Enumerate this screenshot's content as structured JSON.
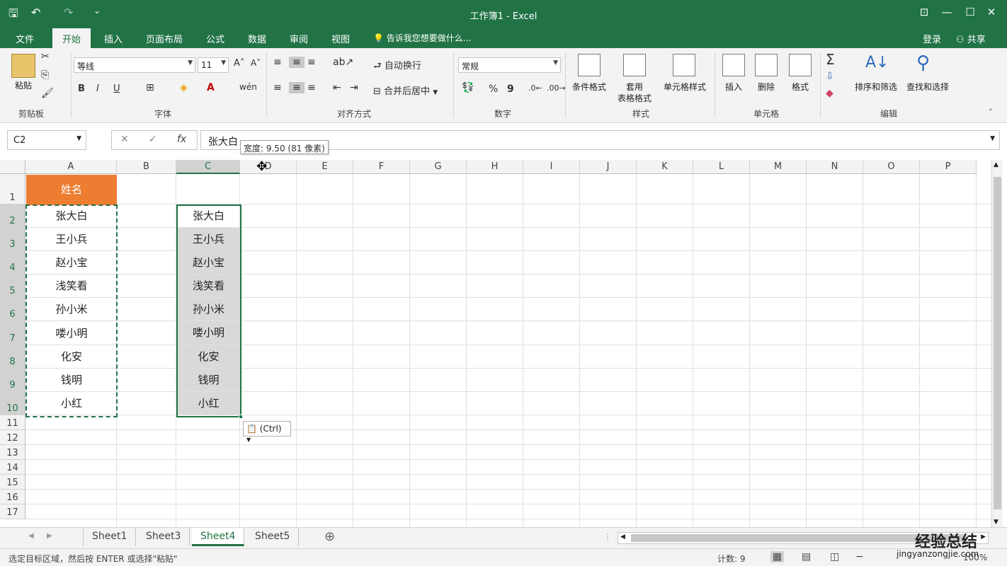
{
  "window": {
    "title": "工作簿1 - Excel",
    "quick_access": {
      "save": "🖫",
      "undo": "↶",
      "redo": "↷",
      "customize": "⌄"
    },
    "controls": {
      "ribbon_display": "⊡",
      "minimize": "—",
      "maximize": "☐",
      "close": "✕"
    }
  },
  "tabs": [
    "文件",
    "开始",
    "插入",
    "页面布局",
    "公式",
    "数据",
    "审阅",
    "视图"
  ],
  "active_tab": "开始",
  "tell_me": "告诉我您想要做什么...",
  "account": {
    "signin": "登录",
    "share": "共享"
  },
  "ribbon": {
    "clipboard": {
      "paste": "粘贴",
      "label": "剪贴板"
    },
    "font": {
      "name": "等线",
      "size": "11",
      "bold": "B",
      "italic": "I",
      "underline": "U",
      "label": "字体"
    },
    "alignment": {
      "wrap": "自动换行",
      "merge": "合并后居中",
      "label": "对齐方式"
    },
    "number": {
      "format": "常规",
      "percent": "%",
      "comma": "9",
      "label": "数字"
    },
    "styles": {
      "conditional": "条件格式",
      "table1": "套用",
      "table2": "表格格式",
      "cell_styles": "单元格样式",
      "label": "样式"
    },
    "cells": {
      "insert": "插入",
      "delete": "删除",
      "format": "格式",
      "label": "单元格"
    },
    "editing": {
      "sort": "排序和筛选",
      "find": "查找和选择",
      "label": "编辑"
    }
  },
  "formula_bar": {
    "name_box": "C2",
    "fx": "fx",
    "cancel": "✕",
    "enter": "✓",
    "value": "张大白",
    "tooltip": "宽度: 9.50 (81 像素)"
  },
  "columns": [
    "A",
    "B",
    "C",
    "D",
    "E",
    "F",
    "G",
    "H",
    "I",
    "J",
    "K",
    "L",
    "M",
    "N",
    "O",
    "P"
  ],
  "rows": [
    "1",
    "2",
    "3",
    "4",
    "5",
    "6",
    "7",
    "8",
    "9",
    "10",
    "11",
    "12",
    "13",
    "14",
    "15",
    "16",
    "17"
  ],
  "cells": {
    "A1": "姓名",
    "A_names": [
      "张大白",
      "王小兵",
      "赵小宝",
      "浅笑看",
      "孙小米",
      "喽小明",
      "化安",
      "钱明",
      "小红"
    ],
    "C_names": [
      "张大白",
      "王小兵",
      "赵小宝",
      "浅笑看",
      "孙小米",
      "喽小明",
      "化安",
      "钱明",
      "小红"
    ]
  },
  "paste_options": "(Ctrl)",
  "sheets": [
    "Sheet1",
    "Sheet3",
    "Sheet4",
    "Sheet5"
  ],
  "active_sheet": "Sheet4",
  "status": {
    "message": "选定目标区域，然后按 ENTER 或选择\"粘贴\"",
    "count": "计数: 9",
    "zoom": "100%"
  },
  "watermark": {
    "line1": "经验总结",
    "line2": "jingyanzongjie.com"
  },
  "colors": {
    "brand": "#217346",
    "header_fill": "#ed7d31",
    "selection_fill": "#d9d9d9"
  }
}
